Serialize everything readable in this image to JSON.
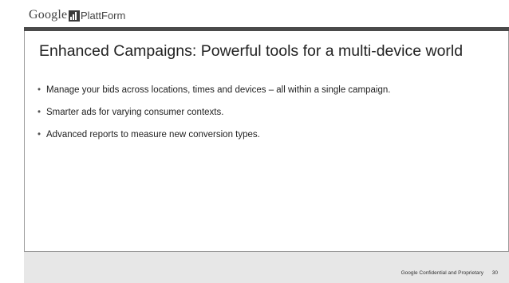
{
  "header": {
    "google_logo": "Google",
    "platt_logo": "PlattForm"
  },
  "slide": {
    "title": "Enhanced Campaigns: Powerful tools for a multi-device world",
    "bullets": [
      "Manage your bids across locations, times and devices – all within a single campaign.",
      "Smarter ads for varying consumer contexts.",
      "Advanced reports to measure new conversion types."
    ],
    "bullet_symbol": "•"
  },
  "footer": {
    "confidential": "Google Confidential and Proprietary",
    "page_number": "30"
  },
  "colors": {
    "header_rule": "#4a4a4a",
    "footer_bg": "#e7e7e7",
    "text": "#222222"
  }
}
